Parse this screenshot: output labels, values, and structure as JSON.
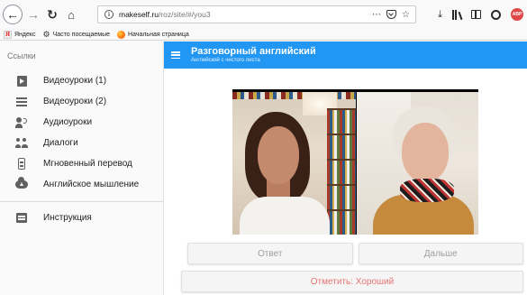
{
  "browser": {
    "url_host": "makeself.ru",
    "url_path": "/roz/site/#/you3",
    "url_actions": "⋯"
  },
  "bookmarks": [
    {
      "label": "Яндекс",
      "icon": "yandex-icon"
    },
    {
      "label": "Часто посещаемые",
      "icon": "gear-icon"
    },
    {
      "label": "Начальная страница",
      "icon": "firefox-icon"
    }
  ],
  "drawer": {
    "subheader": "Ссылки",
    "items": [
      {
        "label": "Видеоуроки (1)",
        "icon": "video-icon"
      },
      {
        "label": "Видеоуроки (2)",
        "icon": "list-icon"
      },
      {
        "label": "Аудиоуроки",
        "icon": "record-voice-icon"
      },
      {
        "label": "Диалоги",
        "icon": "people-icon"
      },
      {
        "label": "Мгновенный перевод",
        "icon": "translate-icon"
      },
      {
        "label": "Английское мышление",
        "icon": "cloud-upload-icon"
      }
    ],
    "secondary_items": [
      {
        "label": "Инструкция",
        "icon": "feedback-icon"
      }
    ]
  },
  "appbar": {
    "title": "Разговорный английский",
    "subtitle": "Английский с чистого листа",
    "color": "#2196f3"
  },
  "video": {
    "participants": 2
  },
  "actions": {
    "answer_label": "Ответ",
    "next_label": "Дальше",
    "mark_label": "Отметить: Хороший",
    "mark_color": "#e57373"
  }
}
